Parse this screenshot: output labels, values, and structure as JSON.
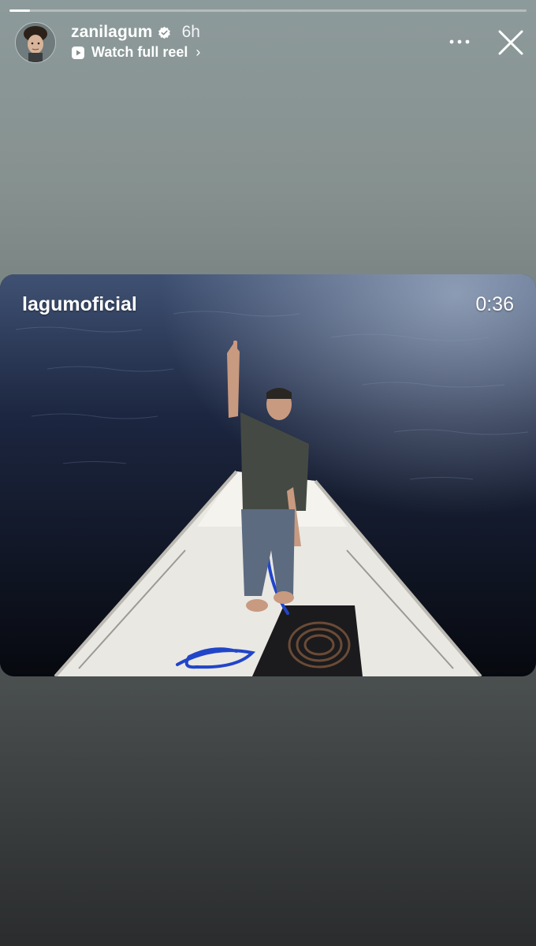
{
  "story": {
    "progress": 0.04,
    "username": "zanilagum",
    "verified": true,
    "time_ago": "6h",
    "watch_full_reel_label": "Watch full reel",
    "watch_full_reel_chevron": "›"
  },
  "reel": {
    "author": "lagumoficial",
    "duration": "0:36"
  },
  "icons": {
    "avatar": "profile-photo",
    "verified": "verified-badge-icon",
    "reel": "play-icon",
    "more": "more-dots-icon",
    "close": "close-icon"
  },
  "colors": {
    "background_top": "#8d9a9b",
    "background_bottom": "#2a2c2d",
    "water": "#111827",
    "boat": "#e9e8e3",
    "rope_blue": "#2145c9"
  }
}
